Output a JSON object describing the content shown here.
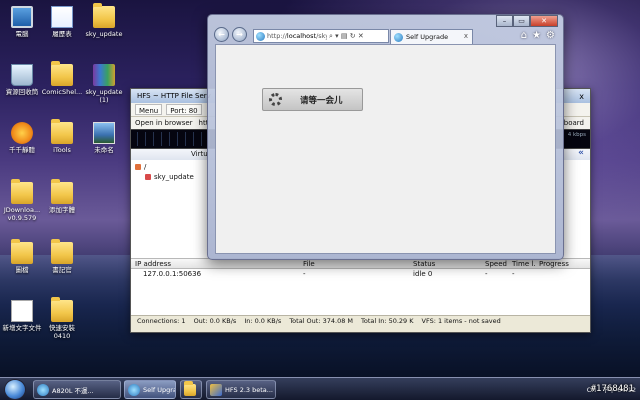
{
  "desktop": {
    "icons": [
      {
        "label": "電腦"
      },
      {
        "label": "履歷表"
      },
      {
        "label": "sky_update"
      },
      {
        "label": "資源回收筒"
      },
      {
        "label": "ComicShel..."
      },
      {
        "label": "sky_update (1)"
      },
      {
        "label": "千千靜聽"
      },
      {
        "label": "iTools"
      },
      {
        "label": "未命名"
      },
      {
        "label": "JDownloa... v0.9.579"
      },
      {
        "label": "添加字體"
      },
      {
        "label": "圖檔"
      },
      {
        "label": "書記官"
      },
      {
        "label": "新增文字文件"
      },
      {
        "label": "快速安裝 0410"
      }
    ]
  },
  "hfs": {
    "title": "HFS ~ HTTP File Serv",
    "close": "x",
    "toolbar": {
      "menu": "Menu",
      "port": "Port: 80"
    },
    "open_in_browser": "Open in browser",
    "url_fragment": "htt",
    "clipboard": "board",
    "graph_label": "4 kbps",
    "vfs_header": "Virtu",
    "vfs_collapse": "«",
    "tree": {
      "root": "/",
      "child": "sky_update"
    },
    "log_columns": [
      "IP address",
      "File",
      "Status",
      "Speed",
      "Time l...",
      "Progress"
    ],
    "log_rows": [
      {
        "ip": "127.0.0.1:50636",
        "file": "-",
        "status": "idle 0",
        "speed": "-",
        "time": "-",
        "progress": ""
      }
    ],
    "status_bar": {
      "connections": "Connections: 1",
      "out": "Out: 0.0 KB/s",
      "in": "In: 0.0 KB/s",
      "total_out": "Total Out: 374.08 M",
      "total_in": "Total In: 50.29 K",
      "vfs": "VFS: 1 items - not saved"
    }
  },
  "ie": {
    "back": "←",
    "forward": "→",
    "address": {
      "prefix": "http://",
      "host": "localhost",
      "rest": "/sky"
    },
    "address_controls": "⌕ ▾ ▤ ↻ ✕",
    "tab_title": "Self Upgrade",
    "tab_close": "x",
    "tools": {
      "home": "⌂",
      "favorites": "★",
      "settings": "⚙"
    },
    "caption": {
      "minimize": "–",
      "maximize": "▭",
      "close": "✕"
    },
    "content": {
      "loading_text": "请等一会儿"
    }
  },
  "taskbar": {
    "items": [
      {
        "label": "A820L 不運..."
      },
      {
        "label": "Self Upgrad..."
      },
      {
        "label": ""
      },
      {
        "label": "HFS 2.3 beta..."
      }
    ],
    "tray": {
      "ime": "CH",
      "time": "下午 04:12"
    }
  },
  "watermark": "#1768481",
  "colors": {
    "ie_frame": "#c8d2e6",
    "hfs_frame": "#ece9d8",
    "desktop_top": "#1a1440"
  }
}
